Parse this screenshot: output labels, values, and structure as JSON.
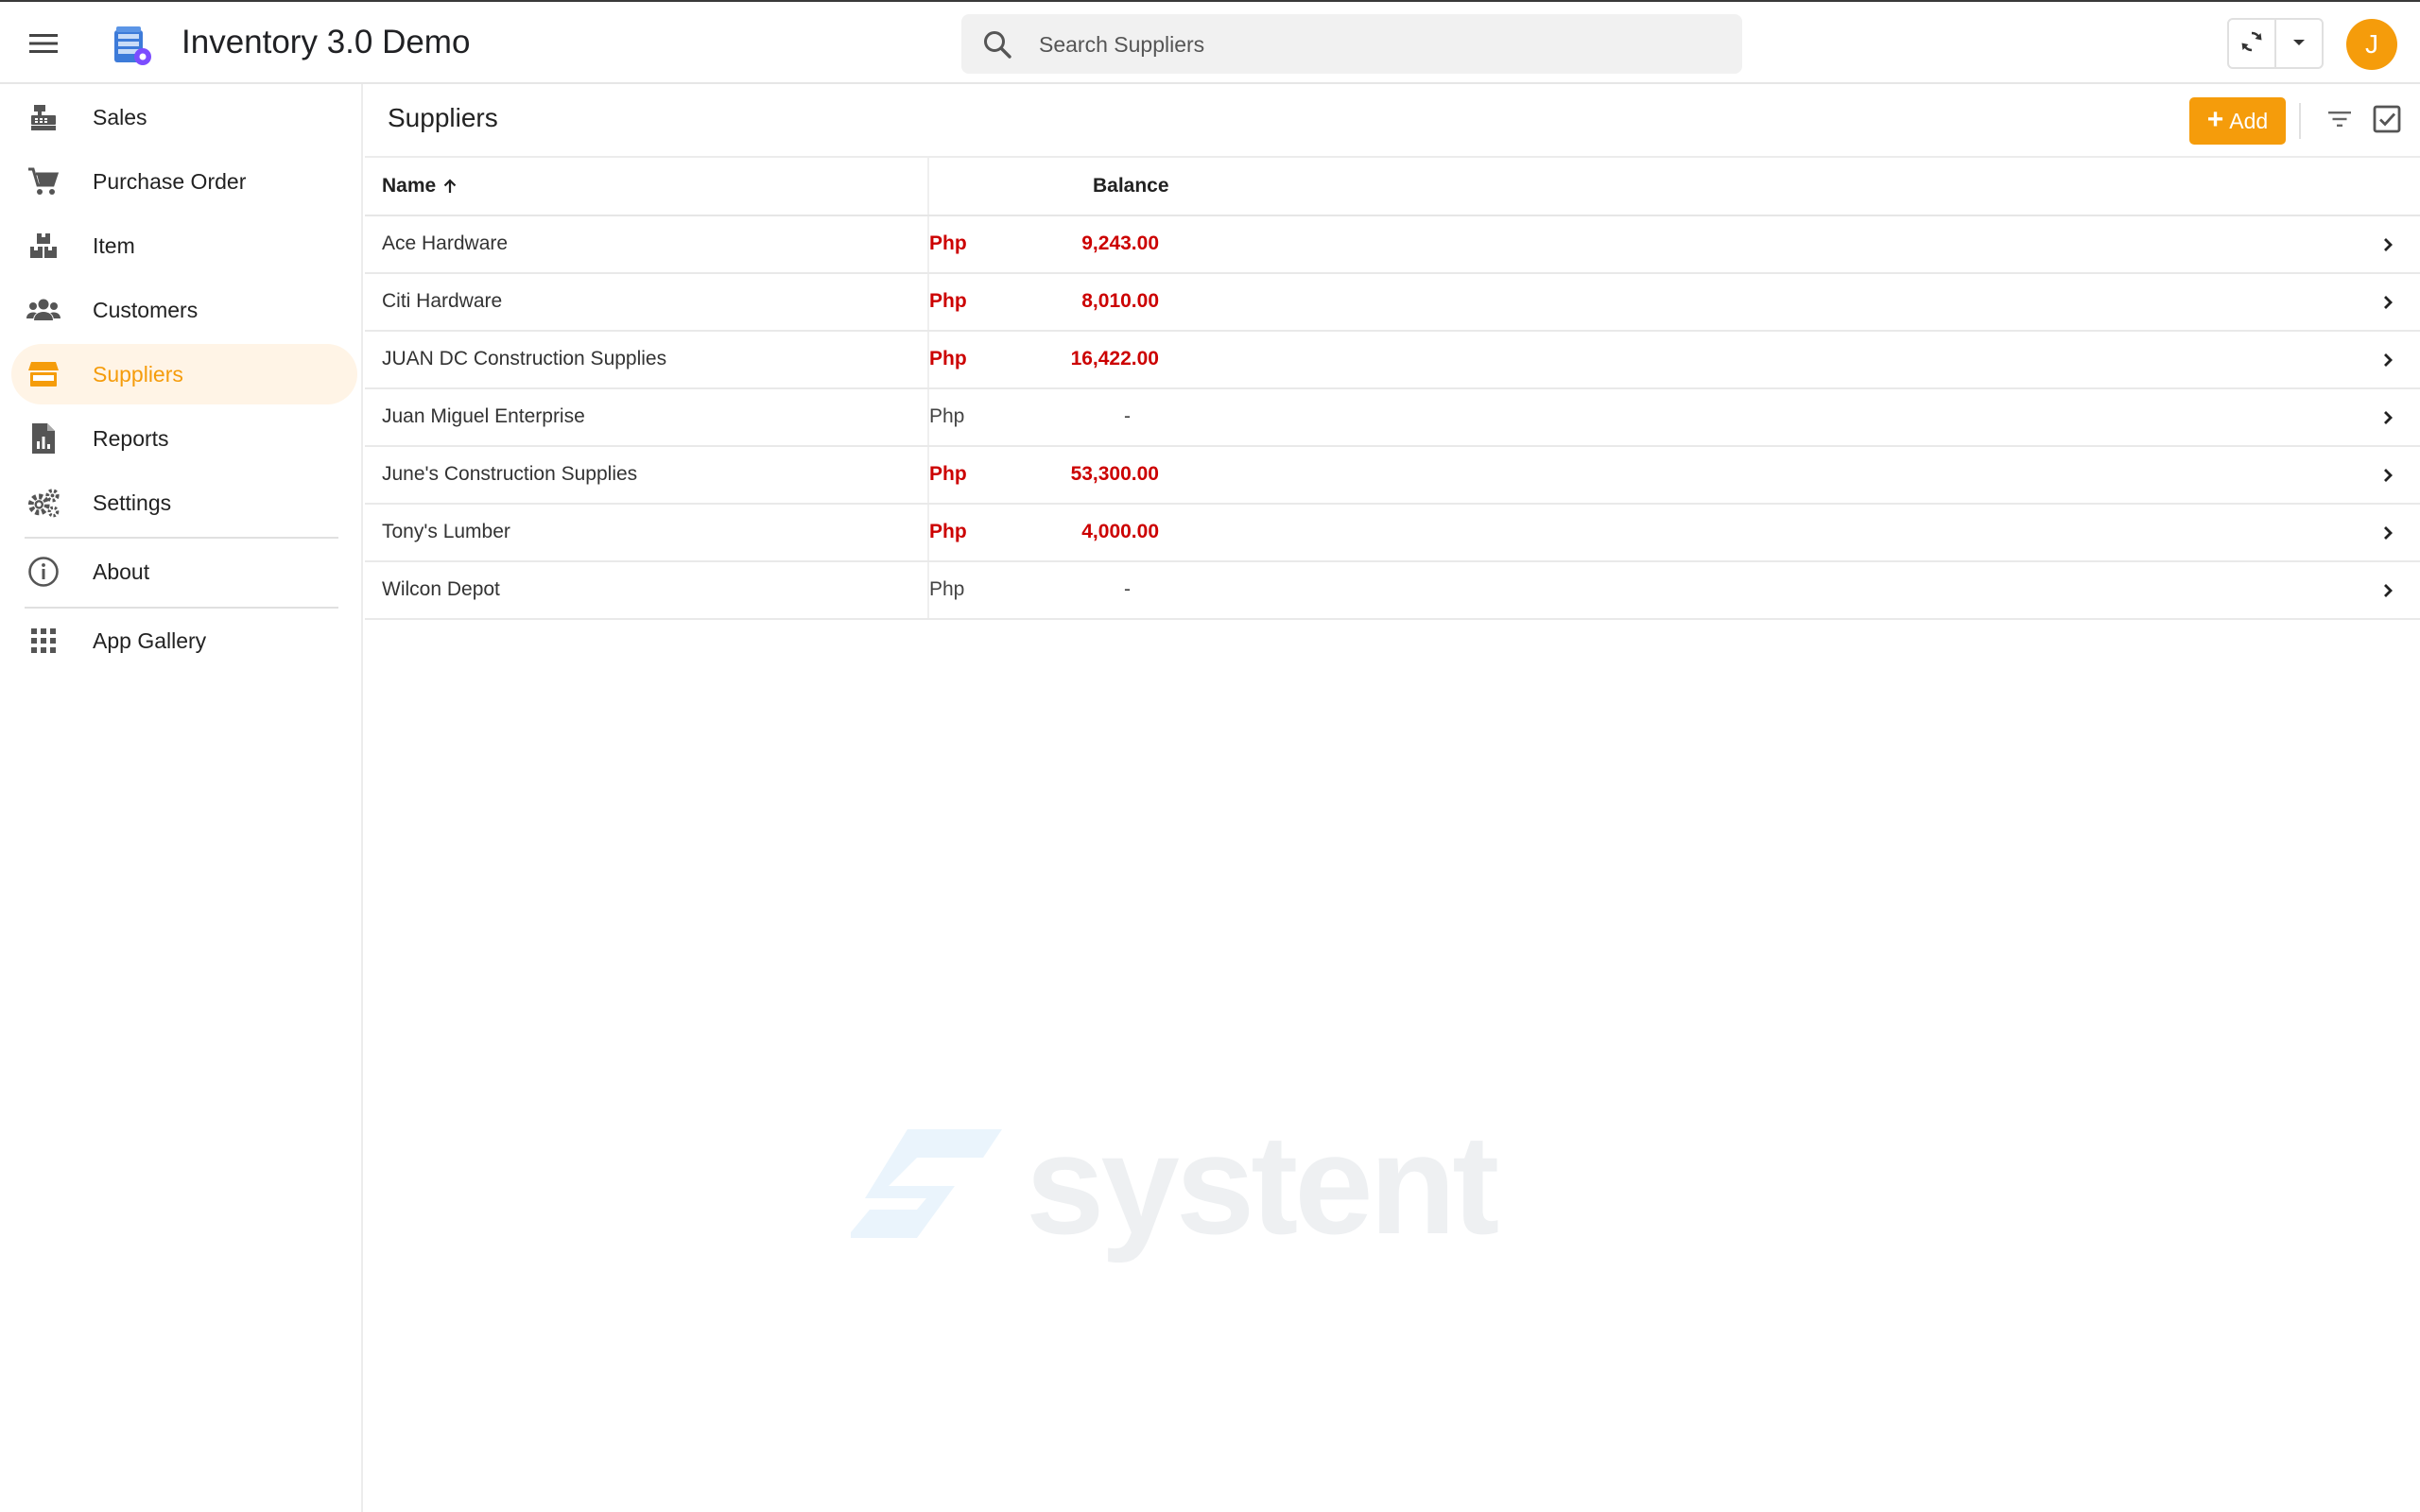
{
  "app": {
    "title": "Inventory 3.0 Demo",
    "accent_color": "#f59c0b",
    "negative_color": "#cc0000"
  },
  "search": {
    "placeholder": "Search Suppliers",
    "value": ""
  },
  "user": {
    "avatar_initial": "J"
  },
  "sidebar": {
    "items": [
      {
        "label": "Sales",
        "icon": "cash-register-icon"
      },
      {
        "label": "Purchase Order",
        "icon": "cart-icon"
      },
      {
        "label": "Item",
        "icon": "boxes-icon"
      },
      {
        "label": "Customers",
        "icon": "users-icon"
      },
      {
        "label": "Suppliers",
        "icon": "store-icon",
        "active": true
      },
      {
        "label": "Reports",
        "icon": "report-icon"
      },
      {
        "label": "Settings",
        "icon": "gears-icon"
      },
      {
        "label": "About",
        "icon": "info-icon"
      },
      {
        "label": "App Gallery",
        "icon": "apps-grid-icon"
      }
    ]
  },
  "main": {
    "title": "Suppliers",
    "add_label": "Add",
    "table": {
      "columns": [
        "Name",
        "Balance"
      ],
      "sort": {
        "column": "Name",
        "direction": "ascending"
      },
      "rows": [
        {
          "name": "Ace Hardware",
          "currency": "Php",
          "balance": "9,243.00",
          "negative": true
        },
        {
          "name": "Citi Hardware",
          "currency": "Php",
          "balance": "8,010.00",
          "negative": true
        },
        {
          "name": "JUAN DC Construction Supplies",
          "currency": "Php",
          "balance": "16,422.00",
          "negative": true
        },
        {
          "name": "Juan Miguel Enterprise",
          "currency": "Php",
          "balance": "-",
          "negative": false
        },
        {
          "name": "June's Construction Supplies",
          "currency": "Php",
          "balance": "53,300.00",
          "negative": true
        },
        {
          "name": "Tony's Lumber",
          "currency": "Php",
          "balance": "4,000.00",
          "negative": true
        },
        {
          "name": "Wilcon Depot",
          "currency": "Php",
          "balance": "-",
          "negative": false
        }
      ]
    }
  },
  "watermark": {
    "text": "systent"
  }
}
